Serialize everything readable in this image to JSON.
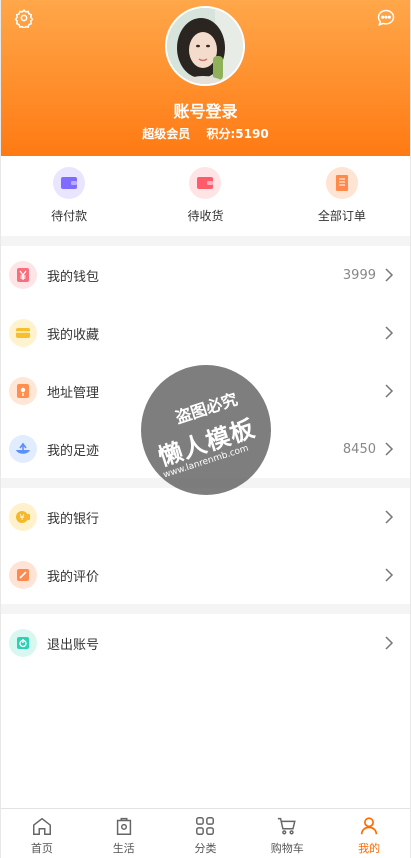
{
  "profile": {
    "login_title": "账号登录",
    "member_level": "超级会员",
    "points": "积分:5190"
  },
  "orders": [
    {
      "label": "待付款",
      "icon": "wallet-icon",
      "color": "#7f6cff",
      "bg": "#e9e5ff"
    },
    {
      "label": "待收货",
      "icon": "purse-icon",
      "color": "#ff5b6b",
      "bg": "#ffe4e6"
    },
    {
      "label": "全部订单",
      "icon": "scroll-icon",
      "color": "#ff8a4c",
      "bg": "#ffe3d3"
    }
  ],
  "menu": [
    {
      "label": "我的钱包",
      "value": "3999",
      "icon": "yen-icon",
      "color": "#f76e7c",
      "bg": "#fde4e6"
    },
    {
      "label": "我的收藏",
      "value": "",
      "icon": "favorite-box-icon",
      "color": "#f6bf2b",
      "bg": "#fff3cf"
    },
    {
      "label": "地址管理",
      "value": "",
      "icon": "location-icon",
      "color": "#ff8f4f",
      "bg": "#ffe6d6"
    },
    {
      "label": "我的足迹",
      "value": "8450",
      "icon": "footprint-icon",
      "color": "#5b8ff9",
      "bg": "#e2ecff"
    },
    {
      "label": "我的银行",
      "value": "",
      "icon": "coin-icon",
      "color": "#f5b82b",
      "bg": "#fff1cc"
    },
    {
      "label": "我的评价",
      "value": "",
      "icon": "edit-icon",
      "color": "#ff8a50",
      "bg": "#ffe4d6"
    },
    {
      "label": "退出账号",
      "value": "",
      "icon": "power-icon",
      "color": "#2fd1b5",
      "bg": "#d9f7f1"
    }
  ],
  "watermark": {
    "top": "盗图必究",
    "middle": "懒人模板",
    "url": "www.lanrenmb.com"
  },
  "tabs": [
    {
      "label": "首页",
      "icon": "home-icon",
      "active": false
    },
    {
      "label": "生活",
      "icon": "bag-icon",
      "active": false
    },
    {
      "label": "分类",
      "icon": "grid-icon",
      "active": false
    },
    {
      "label": "购物车",
      "icon": "cart-icon",
      "active": false
    },
    {
      "label": "我的",
      "icon": "user-icon",
      "active": true
    }
  ],
  "colors": {
    "accent": "#ff6a00",
    "header_top": "#ffa74a",
    "header_bottom": "#ff7a13"
  }
}
